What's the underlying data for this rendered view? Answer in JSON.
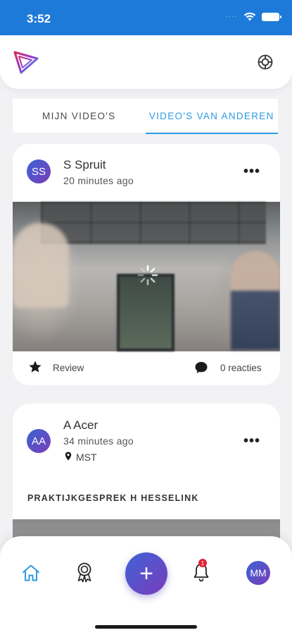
{
  "status_bar": {
    "time": "3:52",
    "signal_dots": "····"
  },
  "header": {
    "logo_icon": "app-logo-icon",
    "settings_icon": "globe-settings-icon"
  },
  "tabs": [
    {
      "label": "MIJN VIDEO'S",
      "active": false
    },
    {
      "label": "VIDEO'S VAN ANDEREN",
      "active": true
    }
  ],
  "posts": [
    {
      "initials": "SS",
      "author": "S Spruit",
      "time": "20 minutes ago",
      "more": "•••",
      "review_label": "Review",
      "comments_label": "0 reacties"
    },
    {
      "initials": "AA",
      "author": "A Acer",
      "time": "34 minutes ago",
      "location": "MST",
      "more": "•••",
      "title": "PRAKTIJKGESPREK H HESSELINK"
    }
  ],
  "bottom_nav": {
    "add_label": "+",
    "notification_count": "1",
    "user_initials": "MM"
  },
  "colors": {
    "accent": "#2d9be2",
    "status_bar": "#1e7ad8",
    "avatar_start": "#3a63d4",
    "avatar_end": "#7a3db8",
    "badge": "#e0223a"
  }
}
